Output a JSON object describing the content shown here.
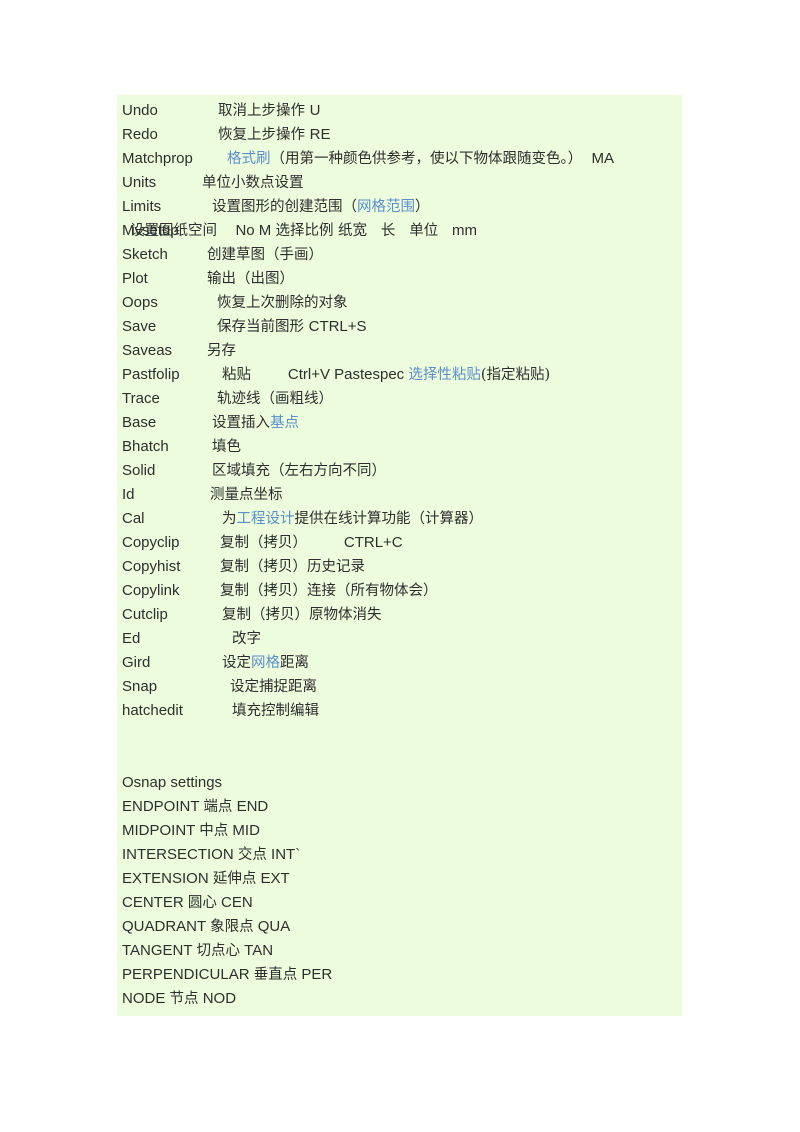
{
  "document": {
    "background_color": "#ffffff",
    "highlight_color": "#edfcdd",
    "text_color": "#2e2e2e",
    "link_color": "#5b8fc9"
  },
  "commands": [
    {
      "name": "Undo",
      "indent": 96,
      "parts": [
        {
          "t": "取消上步操作 ",
          "blue": false
        },
        {
          "t": "U",
          "blue": false,
          "latin": true
        }
      ]
    },
    {
      "name": "Redo",
      "indent": 96,
      "parts": [
        {
          "t": "恢复上步操作 ",
          "blue": false
        },
        {
          "t": "RE",
          "blue": false,
          "latin": true
        }
      ]
    },
    {
      "name": "Matchprop",
      "indent": 105,
      "parts": [
        {
          "t": "格式刷",
          "blue": true
        },
        {
          "t": "（用第一种颜色供参考，使以下物体跟随变色。）  ",
          "blue": false
        },
        {
          "t": "MA",
          "blue": false,
          "latin": true
        }
      ]
    },
    {
      "name": "Units",
      "indent": 80,
      "parts": [
        {
          "t": "单位小数点设置",
          "blue": false
        }
      ]
    },
    {
      "name": "Limits",
      "indent": 90,
      "parts": [
        {
          "t": "设置图形的创建范围（",
          "blue": false
        },
        {
          "t": "网格范围",
          "blue": true
        },
        {
          "t": "）",
          "blue": false
        }
      ]
    },
    {
      "name": "Mvsetup",
      "indent": 8,
      "parts": [
        {
          "t": "设置图纸空间    ",
          "blue": false
        },
        {
          "t": "No M ",
          "blue": false,
          "latin": true
        },
        {
          "t": "选择比例 纸宽   长   单位   ",
          "blue": false
        },
        {
          "t": "mm",
          "blue": false,
          "latin": true
        }
      ]
    },
    {
      "name": "Sketch",
      "indent": 85,
      "parts": [
        {
          "t": "创建草图（手画）",
          "blue": false
        }
      ]
    },
    {
      "name": "Plot",
      "indent": 85,
      "parts": [
        {
          "t": "输出（出图）",
          "blue": false
        }
      ]
    },
    {
      "name": "Oops",
      "indent": 95,
      "parts": [
        {
          "t": "恢复上次删除的对象",
          "blue": false
        }
      ]
    },
    {
      "name": "Save",
      "indent": 95,
      "parts": [
        {
          "t": "保存当前图形 ",
          "blue": false
        },
        {
          "t": "CTRL+S",
          "blue": false,
          "latin": true
        }
      ]
    },
    {
      "name": "Saveas",
      "indent": 85,
      "parts": [
        {
          "t": "另存",
          "blue": false
        }
      ]
    },
    {
      "name": "Pastfolip",
      "indent": 100,
      "parts": [
        {
          "t": "粘贴        ",
          "blue": false
        },
        {
          "t": "Ctrl+V Pastespec ",
          "blue": false,
          "latin": true
        },
        {
          "t": "选择性粘贴",
          "blue": true
        },
        {
          "t": "(指定粘贴)",
          "blue": false
        }
      ]
    },
    {
      "name": "Trace",
      "indent": 95,
      "parts": [
        {
          "t": "轨迹线（画粗线）",
          "blue": false
        }
      ]
    },
    {
      "name": "Base",
      "indent": 90,
      "parts": [
        {
          "t": "设置插入",
          "blue": false
        },
        {
          "t": "基点",
          "blue": true
        }
      ]
    },
    {
      "name": "Bhatch",
      "indent": 90,
      "parts": [
        {
          "t": "填色",
          "blue": false
        }
      ]
    },
    {
      "name": "Solid",
      "indent": 90,
      "parts": [
        {
          "t": "区域填充（左右方向不同）",
          "blue": false
        }
      ]
    },
    {
      "name": "Id",
      "indent": 88,
      "parts": [
        {
          "t": "测量点坐标",
          "blue": false
        }
      ]
    },
    {
      "name": "Cal",
      "indent": 100,
      "parts": [
        {
          "t": "为",
          "blue": false
        },
        {
          "t": "工程设计",
          "blue": true
        },
        {
          "t": "提供在线计算功能（计算器）",
          "blue": false
        }
      ]
    },
    {
      "name": "Copyclip",
      "indent": 98,
      "parts": [
        {
          "t": "复制（拷贝）        ",
          "blue": false
        },
        {
          "t": "CTRL+C",
          "blue": false,
          "latin": true
        }
      ]
    },
    {
      "name": "Copyhist",
      "indent": 98,
      "parts": [
        {
          "t": "复制（拷贝）历史记录",
          "blue": false
        }
      ]
    },
    {
      "name": "Copylink",
      "indent": 98,
      "parts": [
        {
          "t": "复制（拷贝）连接（所有物体会）",
          "blue": false
        }
      ]
    },
    {
      "name": "Cutclip",
      "indent": 100,
      "parts": [
        {
          "t": "复制（拷贝）原物体消失",
          "blue": false
        }
      ]
    },
    {
      "name": "Ed",
      "indent": 110,
      "parts": [
        {
          "t": "改字",
          "blue": false
        }
      ]
    },
    {
      "name": "Gird",
      "indent": 100,
      "parts": [
        {
          "t": "设定",
          "blue": false
        },
        {
          "t": "网格",
          "blue": true
        },
        {
          "t": "距离",
          "blue": false
        }
      ]
    },
    {
      "name": "Snap",
      "indent": 108,
      "parts": [
        {
          "t": "设定捕捉距离",
          "blue": false
        }
      ]
    },
    {
      "name": "hatchedit",
      "indent": 110,
      "parts": [
        {
          "t": "填充控制编辑",
          "blue": false
        }
      ]
    }
  ],
  "osnap": {
    "heading": "Osnap settings",
    "entries": [
      {
        "en": "ENDPOINT",
        "cn": "端点",
        "abbr": "END"
      },
      {
        "en": "MIDPOINT",
        "cn": "中点",
        "abbr": "MID"
      },
      {
        "en": "INTERSECTION",
        "cn": "交点",
        "abbr": "INT`"
      },
      {
        "en": "EXTENSION",
        "cn": "延伸点",
        "abbr": "EXT"
      },
      {
        "en": "CENTER",
        "cn": "圆心",
        "abbr": "CEN"
      },
      {
        "en": "QUADRANT",
        "cn": "象限点",
        "abbr": "QUA"
      },
      {
        "en": "TANGENT",
        "cn": "切点心",
        "abbr": "TAN"
      },
      {
        "en": "PERPENDICULAR",
        "cn": "垂直点",
        "abbr": "PER"
      },
      {
        "en": "NODE",
        "cn": "节点",
        "abbr": "NOD"
      }
    ]
  }
}
